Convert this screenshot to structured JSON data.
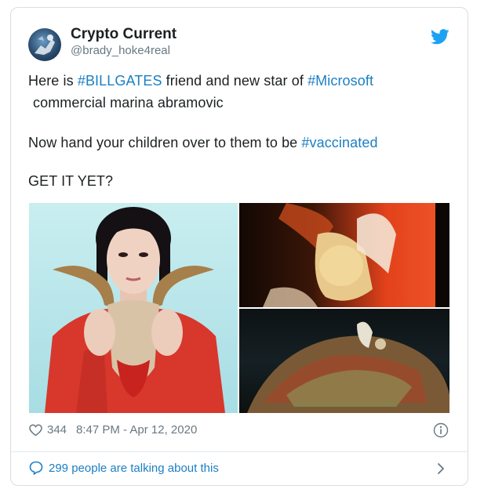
{
  "user": {
    "name": "Crypto Current",
    "handle": "@brady_hoke4real"
  },
  "tweet": {
    "line1": {
      "t1": "Here is ",
      "tag1": "#BILLGATES",
      "t2": " friend and new star of ",
      "tag2": "#Microsoft"
    },
    "line2": "commercial marina abramovic",
    "line3": {
      "t1": "Now hand your children over to them to be ",
      "tag1": "#vaccinated"
    },
    "line4": "GET IT YET?"
  },
  "meta": {
    "likes": "344",
    "timestamp": "8:47 PM - Apr 12, 2020"
  },
  "footer": {
    "talking": "299 people are talking about this"
  },
  "icons": {
    "brand": "twitter-bird-icon",
    "like": "heart-icon",
    "info": "info-icon",
    "reply": "speech-bubble-icon",
    "more": "chevron-right-icon"
  },
  "colors": {
    "link": "#1b7fc4",
    "muted": "#697882",
    "brand": "#1da1f2",
    "text": "#1c2022"
  }
}
